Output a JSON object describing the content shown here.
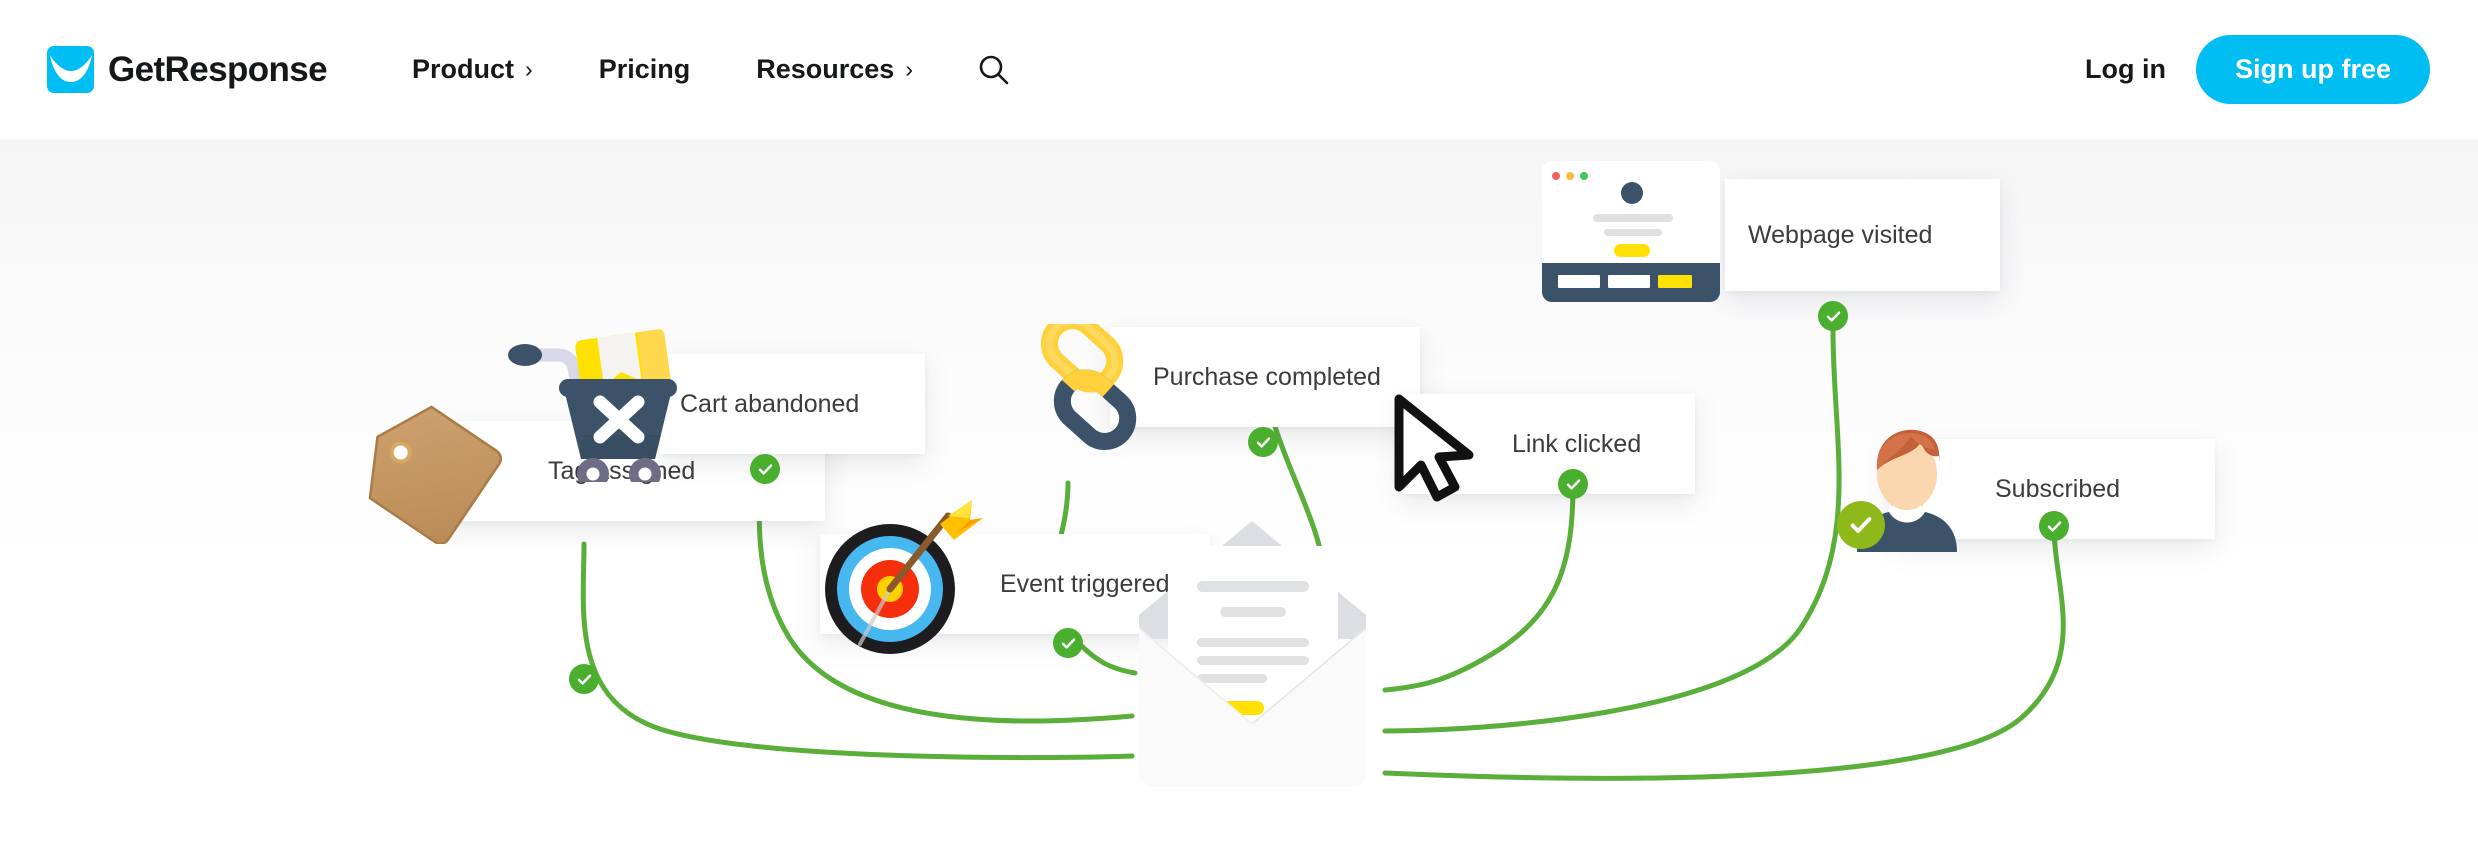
{
  "header": {
    "brand": {
      "name": "GetResponse",
      "logo_icon": "getresponse-envelope-logo",
      "color": "#00bdf2"
    },
    "nav": [
      {
        "label": "Product",
        "has_chevron": true,
        "chevron": "›"
      },
      {
        "label": "Pricing",
        "has_chevron": false,
        "chevron": ""
      },
      {
        "label": "Resources",
        "has_chevron": true,
        "chevron": "›"
      }
    ],
    "search_icon": "search-icon",
    "login_label": "Log in",
    "signup_label": "Sign up free"
  },
  "hero": {
    "center_icon": "open-envelope-with-letter",
    "connector_color": "#5aae3a",
    "cards": [
      {
        "id": "cart-abandoned",
        "label": "Cart abandoned",
        "icon": "shopping-cart-x-icon"
      },
      {
        "id": "purchase-completed",
        "label": "Purchase completed",
        "icon": "chain-link-icon"
      },
      {
        "id": "webpage-visited",
        "label": "Webpage visited",
        "icon": "browser-window-icon"
      },
      {
        "id": "tag-assigned",
        "label": "Tag assigned",
        "icon": "price-tag-icon"
      },
      {
        "id": "event-triggered",
        "label": "Event triggered",
        "icon": "target-arrow-icon"
      },
      {
        "id": "link-clicked",
        "label": "Link clicked",
        "icon": "mouse-cursor-icon"
      },
      {
        "id": "subscribed",
        "label": "Subscribed",
        "icon": "user-avatar-icon"
      }
    ]
  },
  "colors": {
    "brand_blue": "#00bdf2",
    "green": "#4aae2f",
    "olive_green": "#8fb91b",
    "yellow": "#ffe000",
    "navy": "#3b5268",
    "text": "#16181c",
    "card_text": "#3c3c3c"
  }
}
